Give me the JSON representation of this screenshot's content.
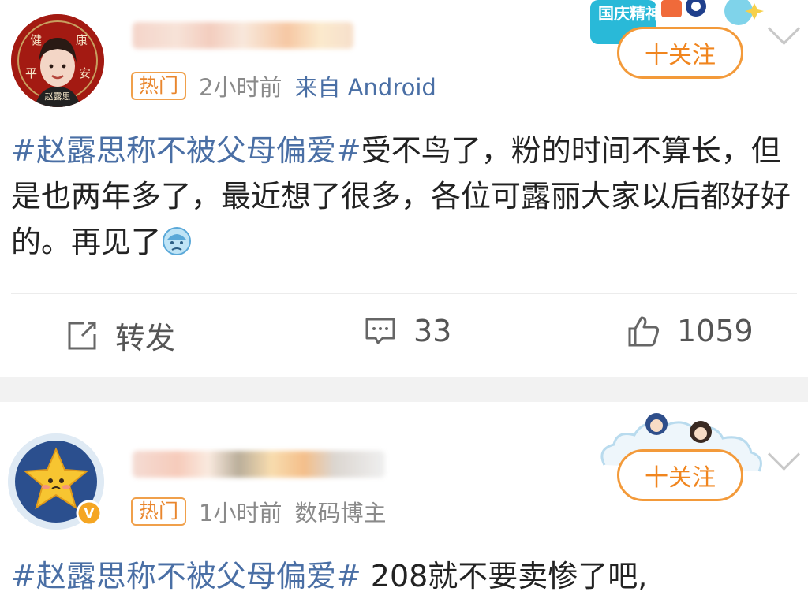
{
  "posts": [
    {
      "avatar": {
        "corner_chars": [
          "健",
          "康",
          "平",
          "安"
        ],
        "name": "赵露思"
      },
      "meta": {
        "badge": "热门",
        "time": "2小时前",
        "source": "来自 Android"
      },
      "follow_label": "十关注",
      "deco_text": "国庆精神",
      "content": {
        "hashtag": "#赵露思称不被父母偏爱#",
        "text": "受不鸟了，粉的时间不算长，但是也两年多了，最近想了很多，各位可露丽大家以后都好好的。再见了"
      },
      "actions": {
        "repost": "转发",
        "comments": "33",
        "likes": "1059"
      }
    },
    {
      "meta": {
        "badge": "热门",
        "time": "1小时前",
        "source": "数码博主"
      },
      "follow_label": "十关注",
      "verified_badge": "V",
      "content": {
        "hashtag": "#赵露思称不被父母偏爱#",
        "text": " 208就不要卖惨了吧,"
      }
    }
  ],
  "colors": {
    "link": "#4a6fa5",
    "accent": "#f39a3a",
    "hot": "#e9862d",
    "meta": "#8a8a8a"
  }
}
